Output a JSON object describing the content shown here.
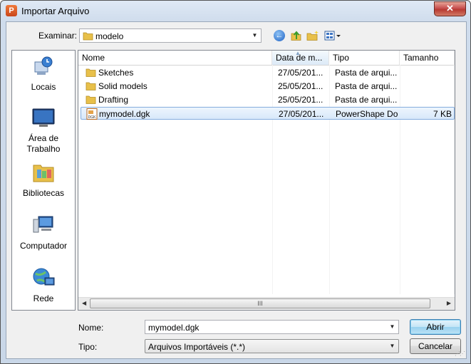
{
  "window": {
    "title": "Importar Arquivo",
    "close_label": "✕"
  },
  "toolbar": {
    "look_in_label": "Examinar:",
    "look_in_value": "modelo"
  },
  "places": [
    {
      "label": "Locais",
      "icon": "recent-places-icon"
    },
    {
      "label": "Área de\nTrabalho",
      "icon": "desktop-icon"
    },
    {
      "label": "Bibliotecas",
      "icon": "libraries-icon"
    },
    {
      "label": "Computador",
      "icon": "computer-icon"
    },
    {
      "label": "Rede",
      "icon": "network-icon"
    }
  ],
  "columns": {
    "name": "Nome",
    "date": "Data de m...",
    "type": "Tipo",
    "size": "Tamanho"
  },
  "files": [
    {
      "name": "Sketches",
      "date": "27/05/201...",
      "type": "Pasta de arqui...",
      "size": "",
      "icon": "folder-icon"
    },
    {
      "name": "Solid models",
      "date": "25/05/201...",
      "type": "Pasta de arqui...",
      "size": "",
      "icon": "folder-icon"
    },
    {
      "name": "Drafting",
      "date": "25/05/201...",
      "type": "Pasta de arqui...",
      "size": "",
      "icon": "folder-icon"
    },
    {
      "name": "mymodel.dgk",
      "date": "27/05/201...",
      "type": "PowerShape Do...",
      "size": "7 KB",
      "icon": "dgk-file-icon",
      "file_icon_text": "DGK"
    }
  ],
  "scrollbar": {
    "thumb_grip": "III"
  },
  "bottom": {
    "name_label": "Nome:",
    "name_value": "mymodel.dgk",
    "type_label": "Tipo:",
    "type_value": "Arquivos Importáveis (*.*)",
    "open_label": "Abrir",
    "cancel_label": "Cancelar"
  },
  "colors": {
    "title_bg": "#cfdcec",
    "selected_row": "#d8e8fa",
    "folder": "#e8c04a",
    "close": "#c75050"
  }
}
